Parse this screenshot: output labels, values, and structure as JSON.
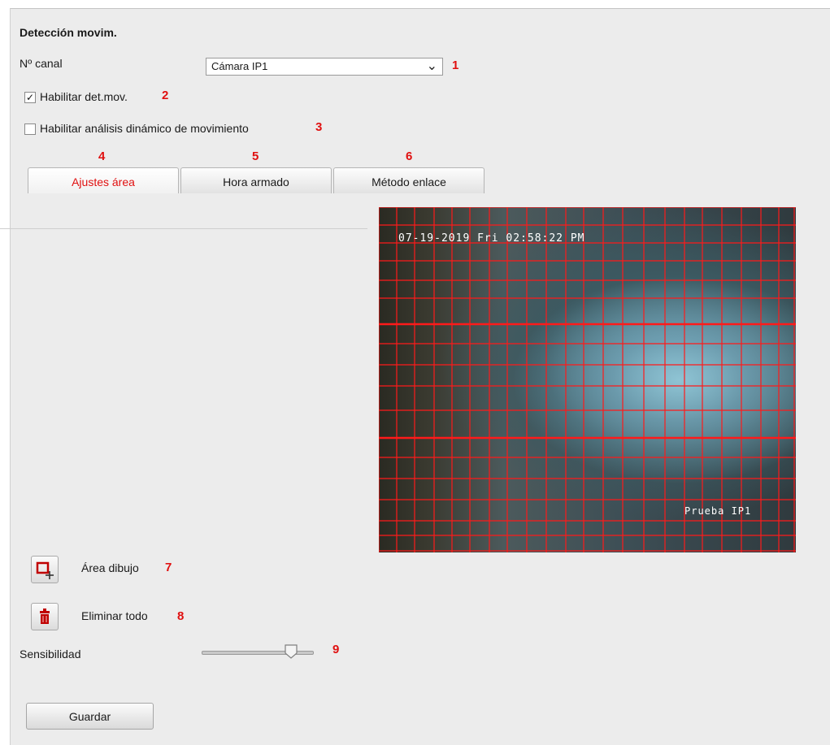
{
  "section_title": "Detección movim.",
  "channel": {
    "label": "Nº canal",
    "selected": "Cámara IP1",
    "marker": "1"
  },
  "enable_motion": {
    "label": "Habilitar det.mov.",
    "checked": true,
    "marker": "2"
  },
  "enable_dynamic": {
    "label": "Habilitar análisis dinámico de movimiento",
    "checked": false,
    "marker": "3"
  },
  "tabs": [
    {
      "label": "Ajustes área",
      "marker": "4",
      "active": true
    },
    {
      "label": "Hora armado",
      "marker": "5",
      "active": false
    },
    {
      "label": "Método enlace",
      "marker": "6",
      "active": false
    }
  ],
  "preview": {
    "timestamp": "07-19-2019 Fri 02:58:22 PM",
    "camera_name": "Prueba IP1"
  },
  "draw_area": {
    "label": "Área dibujo",
    "marker": "7"
  },
  "clear_all": {
    "label": "Eliminar todo",
    "marker": "8"
  },
  "sensitivity": {
    "label": "Sensibilidad",
    "marker": "9",
    "value": 0.8
  },
  "save_label": "Guardar",
  "colors": {
    "marker": "#e01010",
    "grid": "#ff1a1a",
    "active_tab": "#e01010"
  },
  "icons": {
    "draw": "draw-area-icon",
    "clear": "trash-icon",
    "dropdown": "chevron-down-icon",
    "check": "checkmark-icon"
  }
}
